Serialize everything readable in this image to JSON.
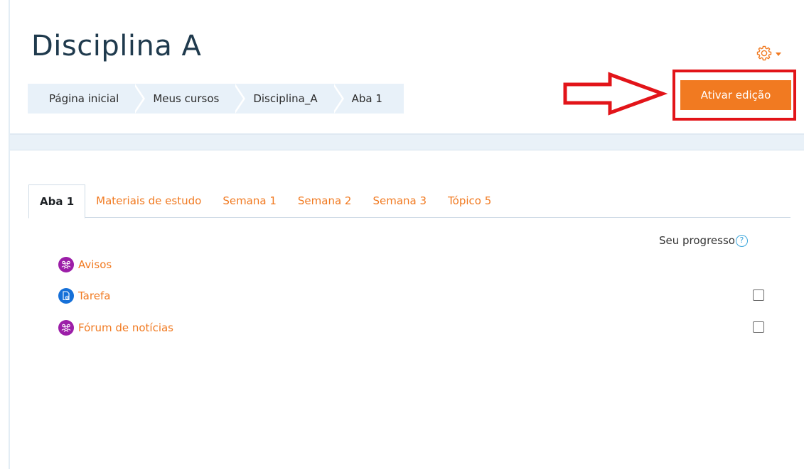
{
  "course": {
    "title": "Disciplina A"
  },
  "breadcrumb": [
    {
      "label": "Página inicial"
    },
    {
      "label": "Meus cursos"
    },
    {
      "label": "Disciplina_A"
    },
    {
      "label": "Aba 1"
    }
  ],
  "actions": {
    "edit_button": "Ativar edição"
  },
  "tabs": [
    {
      "label": "Aba 1"
    },
    {
      "label": "Materiais de estudo"
    },
    {
      "label": "Semana 1"
    },
    {
      "label": "Semana 2"
    },
    {
      "label": "Semana 3"
    },
    {
      "label": "Tópico 5"
    }
  ],
  "progress": {
    "label": "Seu progresso",
    "help_icon": "?"
  },
  "activities": [
    {
      "label": "Avisos",
      "icon": "forum-icon",
      "color": "#9c1ea8"
    },
    {
      "label": "Tarefa",
      "icon": "assignment-icon",
      "color": "#1670d8"
    },
    {
      "label": "Fórum de notícias",
      "icon": "forum-icon",
      "color": "#9c1ea8"
    }
  ],
  "colors": {
    "accent": "#f17a21",
    "annotation_red": "#e21419",
    "breadcrumb_bg": "#e8f1f9",
    "title": "#1f3a4d"
  }
}
